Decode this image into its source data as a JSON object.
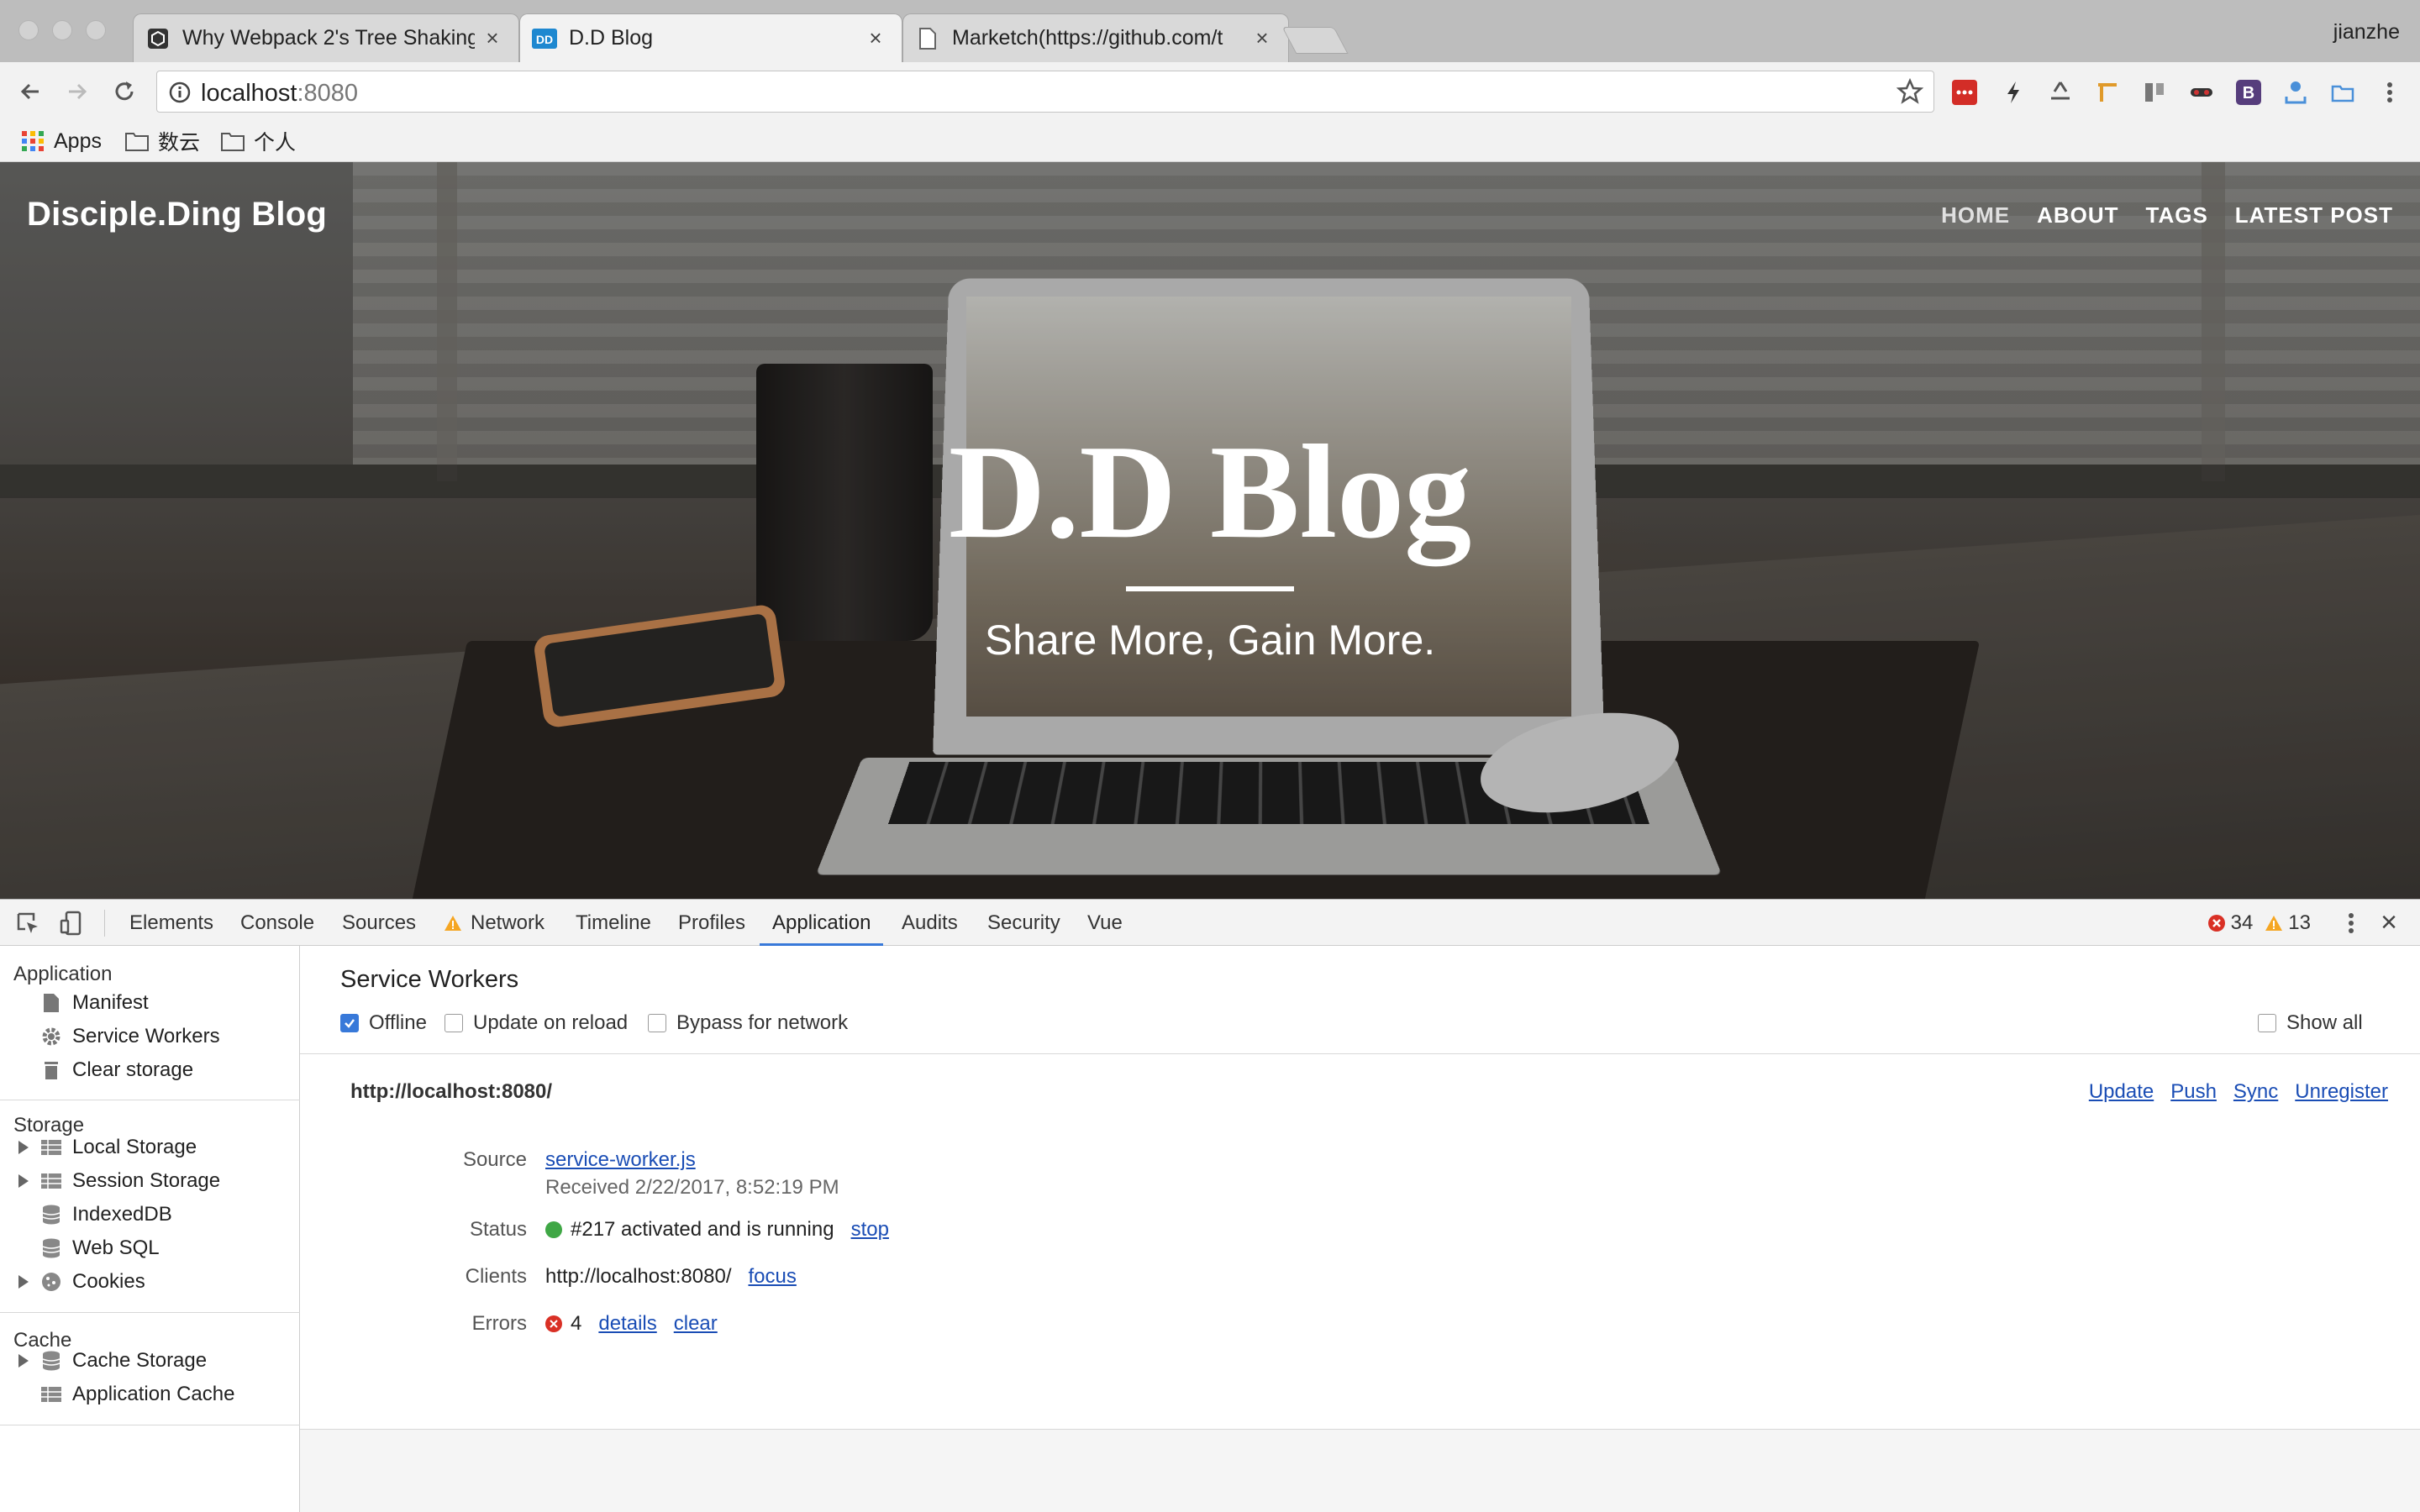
{
  "browser": {
    "tabs": [
      {
        "title": "Why Webpack 2's Tree Shaking",
        "favicon": "webpack-icon"
      },
      {
        "title": "D.D Blog",
        "favicon": "dd-logo-icon"
      },
      {
        "title": "Marketch(https://github.com/t",
        "favicon": "document-icon"
      }
    ],
    "profile": "jianzhe",
    "url_host": "localhost",
    "url_rest": ":8080",
    "bookmarks": [
      {
        "label": "Apps",
        "icon": "apps-grid-icon"
      },
      {
        "label": "数云",
        "icon": "folder-icon"
      },
      {
        "label": "个人",
        "icon": "folder-icon"
      }
    ]
  },
  "blog": {
    "brand": "Disciple.Ding Blog",
    "nav": [
      "HOME",
      "ABOUT",
      "TAGS",
      "LATEST POST"
    ],
    "title": "D.D Blog",
    "subtitle": "Share More, Gain More."
  },
  "devtools": {
    "tabs": [
      "Elements",
      "Console",
      "Sources",
      "Network",
      "Timeline",
      "Profiles",
      "Application",
      "Audits",
      "Security",
      "Vue"
    ],
    "active_tab": "Application",
    "error_count": "34",
    "warning_count": "13",
    "sidebar": {
      "application_header": "Application",
      "application_items": [
        "Manifest",
        "Service Workers",
        "Clear storage"
      ],
      "storage_header": "Storage",
      "storage_items": [
        "Local Storage",
        "Session Storage",
        "IndexedDB",
        "Web SQL",
        "Cookies"
      ],
      "cache_header": "Cache",
      "cache_items": [
        "Cache Storage",
        "Application Cache"
      ]
    },
    "service_workers": {
      "title": "Service Workers",
      "options": {
        "offline": "Offline",
        "update_on_reload": "Update on reload",
        "bypass": "Bypass for network",
        "show_all": "Show all"
      },
      "origin": "http://localhost:8080/",
      "actions": [
        "Update",
        "Push",
        "Sync",
        "Unregister"
      ],
      "labels": {
        "source": "Source",
        "status": "Status",
        "clients": "Clients",
        "errors": "Errors"
      },
      "source_file": "service-worker.js",
      "received": "Received 2/22/2017, 8:52:19 PM",
      "status_text": "#217 activated and is running",
      "status_action": "stop",
      "client_url": "http://localhost:8080/",
      "client_action": "focus",
      "error_count": "4",
      "error_details": "details",
      "error_clear": "clear"
    }
  },
  "colors": {
    "accent": "#3879d9",
    "link": "#1a4db5",
    "running": "#3fa745",
    "error": "#d93025",
    "warning": "#f5a623"
  }
}
